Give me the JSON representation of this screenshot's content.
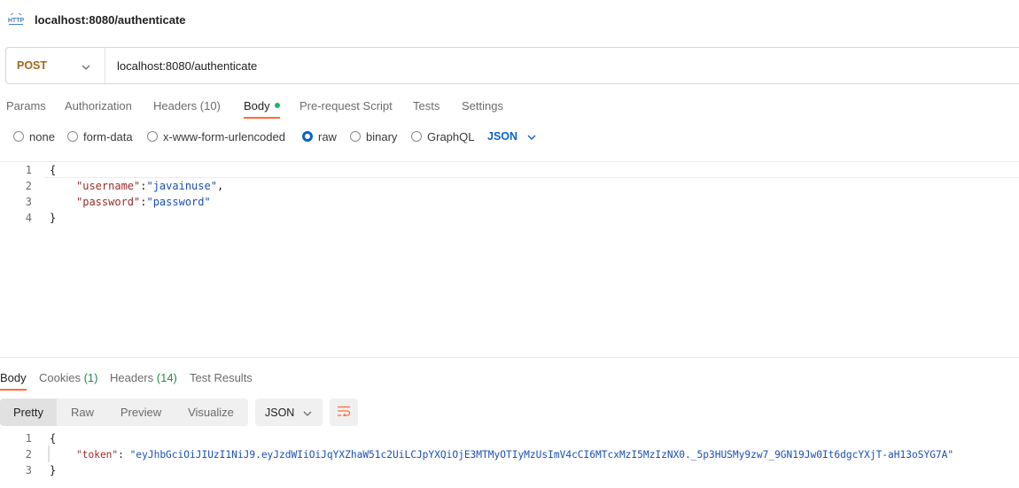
{
  "tab_title": "localhost:8080/authenticate",
  "request": {
    "method": "POST",
    "url": "localhost:8080/authenticate"
  },
  "request_tabs": [
    {
      "label": "Params"
    },
    {
      "label": "Authorization"
    },
    {
      "label": "Headers",
      "count": "(10)"
    },
    {
      "label": "Body",
      "active": true
    },
    {
      "label": "Pre-request Script"
    },
    {
      "label": "Tests"
    },
    {
      "label": "Settings"
    }
  ],
  "body_types": [
    {
      "label": "none",
      "checked": false
    },
    {
      "label": "form-data",
      "checked": false
    },
    {
      "label": "x-www-form-urlencoded",
      "checked": false
    },
    {
      "label": "raw",
      "checked": true
    },
    {
      "label": "binary",
      "checked": false
    },
    {
      "label": "GraphQL",
      "checked": false
    }
  ],
  "body_format": "JSON",
  "request_body": {
    "lines": [
      {
        "n": "1",
        "text": "{"
      },
      {
        "n": "2",
        "key": "\"username\"",
        "sep": ":",
        "value": "\"javainuse\"",
        "tail": ","
      },
      {
        "n": "3",
        "key": "\"password\"",
        "sep": ":",
        "value": "\"password\"",
        "tail": ""
      },
      {
        "n": "4",
        "text": "}"
      }
    ]
  },
  "response_tabs": [
    {
      "label": "Body",
      "active": true
    },
    {
      "label": "Cookies",
      "count": "(1)"
    },
    {
      "label": "Headers",
      "count": "(14)"
    },
    {
      "label": "Test Results"
    }
  ],
  "response_view": {
    "modes": [
      "Pretty",
      "Raw",
      "Preview",
      "Visualize"
    ],
    "active_mode": "Pretty",
    "format": "JSON"
  },
  "response_body": {
    "lines": [
      {
        "n": "1",
        "text": "{"
      },
      {
        "n": "2",
        "key": "\"token\"",
        "sep": ": ",
        "value": "\"eyJhbGciOiJIUzI1NiJ9.eyJzdWIiOiJqYXZhaW51c2UiLCJpYXQiOjE3MTMyOTIyMzUsImV4cCI6MTcxMzI5MzIzNX0._5p3HUSMy9zw7_9GN19Jw0It6dgcYXjT-aH13oSYG7A\""
      },
      {
        "n": "3",
        "text": "}"
      }
    ]
  },
  "colors": {
    "method": "#a6651b",
    "accent": "#ff6c37",
    "link_blue": "#0b63c5",
    "body_dot": "#1fb36b",
    "json_key": "#9a2b2b",
    "json_string": "#1b4fb3"
  }
}
